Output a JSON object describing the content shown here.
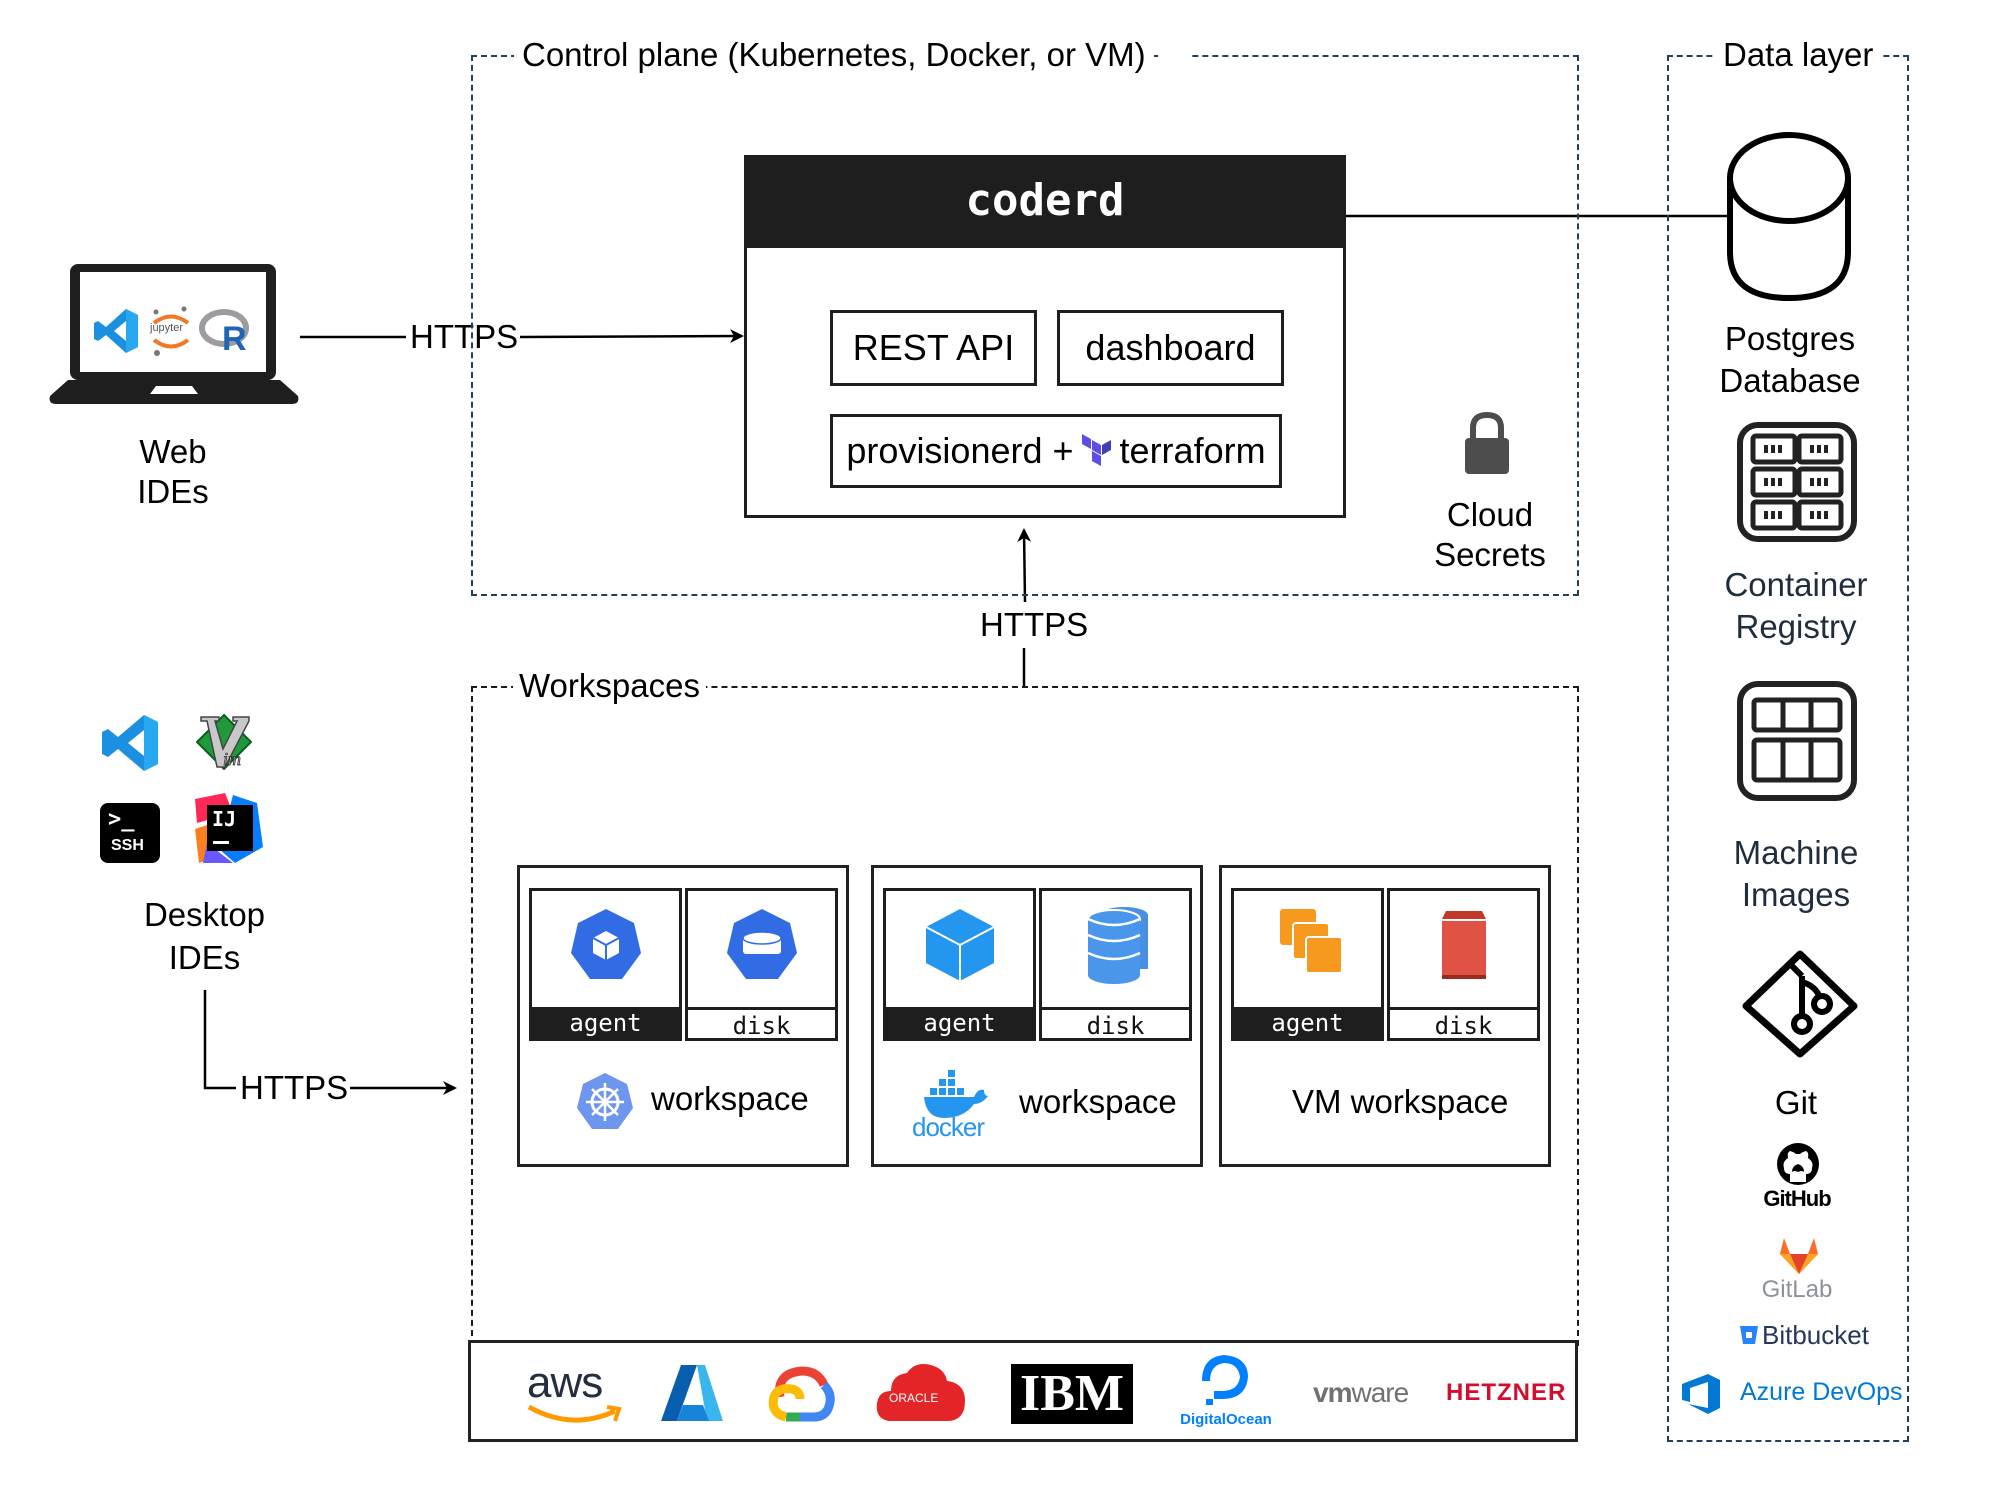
{
  "client_web": {
    "label_line1": "Web",
    "label_line2": "IDEs",
    "icons": [
      "vscode-icon",
      "jupyter-icon",
      "r-icon"
    ],
    "jupyter_text": "jupyter"
  },
  "client_desktop": {
    "label_line1": "Desktop",
    "label_line2": "IDEs",
    "icons": [
      "vscode-icon",
      "vim-icon",
      "ssh-icon",
      "intellij-icon"
    ],
    "ssh_prompt": ">_",
    "ssh_text": "SSH",
    "ij_text": "IJ"
  },
  "connections": {
    "web_to_coderd": "HTTPS",
    "workspaces_to_coderd": "HTTPS",
    "desktop_to_workspaces": "HTTPS"
  },
  "control_plane": {
    "title": "Control plane (Kubernetes, Docker, or VM)",
    "coderd": {
      "title": "coderd",
      "rest_api": "REST API",
      "dashboard": "dashboard",
      "provisioner_prefix": "provisionerd +",
      "provisioner_suffix": "terraform"
    },
    "secrets": {
      "label_line1": "Cloud",
      "label_line2": "Secrets"
    }
  },
  "workspaces": {
    "title": "Workspaces",
    "cards": [
      {
        "platform": "kubernetes",
        "agent_label": "agent",
        "disk_label": "disk",
        "caption": "workspace"
      },
      {
        "platform": "docker",
        "agent_label": "agent",
        "disk_label": "disk",
        "caption": "workspace",
        "logo_text": "docker"
      },
      {
        "platform": "vm",
        "agent_label": "agent",
        "disk_label": "disk",
        "caption": "VM workspace"
      }
    ],
    "cloud_providers": [
      "aws",
      "Azure",
      "Google Cloud",
      "ORACLE",
      "IBM",
      "DigitalOcean",
      "vmware",
      "HETZNER"
    ],
    "logo_texts": {
      "aws": "aws",
      "oracle": "ORACLE",
      "ibm": "IBM",
      "digitalocean": "DigitalOcean",
      "vmware_bold": "vm",
      "vmware_light": "ware",
      "hetzner": "HETZNER"
    }
  },
  "data_layer": {
    "title": "Data layer",
    "postgres": {
      "line1": "Postgres",
      "line2": "Database"
    },
    "registry": {
      "line1": "Container",
      "line2": "Registry"
    },
    "machine_images": {
      "line1": "Machine",
      "line2": "Images"
    },
    "git": {
      "label": "Git",
      "providers": {
        "github": "GitHub",
        "gitlab": "GitLab",
        "bitbucket": "Bitbucket",
        "azure_devops": "Azure DevOps"
      }
    }
  },
  "colors": {
    "frame_dash": "#23405a",
    "coderd_header": "#1e1e1e",
    "kubernetes": "#326ce5",
    "docker": "#2496ed",
    "aws_orange": "#f7981f",
    "aws_red": "#e05243",
    "terraform": "#5c4ee5",
    "hetzner": "#d50c2d",
    "digitalocean": "#0080ff"
  }
}
